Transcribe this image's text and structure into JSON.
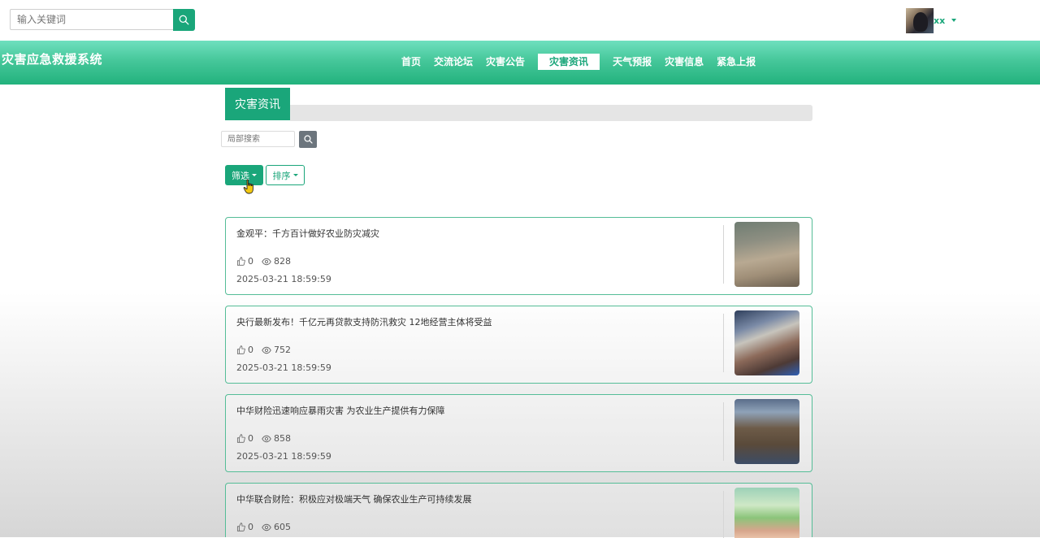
{
  "header": {
    "search_placeholder": "输入关键词",
    "username": "xx"
  },
  "navbar": {
    "brand": "灾害应急救援系统",
    "items": [
      {
        "label": "首页",
        "active": false
      },
      {
        "label": "交流论坛",
        "active": false
      },
      {
        "label": "灾害公告",
        "active": false
      },
      {
        "label": "灾害资讯",
        "active": true
      },
      {
        "label": "天气预报",
        "active": false
      },
      {
        "label": "灾害信息",
        "active": false
      },
      {
        "label": "紧急上报",
        "active": false
      }
    ]
  },
  "section": {
    "title": "灾害资讯",
    "local_search_placeholder": "局部搜索",
    "filter_label": "筛选",
    "sort_label": "排序"
  },
  "articles": [
    {
      "title": "金观平：千方百计做好农业防灾减灾",
      "likes": "0",
      "views": "828",
      "date": "2025-03-21 18:59:59"
    },
    {
      "title": "央行最新发布！千亿元再贷款支持防汛救灾 12地经营主体将受益",
      "likes": "0",
      "views": "752",
      "date": "2025-03-21 18:59:59"
    },
    {
      "title": "中华财险迅速响应暴雨灾害 为农业生产提供有力保障",
      "likes": "0",
      "views": "858",
      "date": "2025-03-21 18:59:59"
    },
    {
      "title": "中华联合财险：积极应对极端天气 确保农业生产可持续发展",
      "likes": "0",
      "views": "605",
      "date": ""
    }
  ],
  "colors": {
    "primary": "#1aa67a",
    "nav_light": "#6fe0bf",
    "card_border": "#55bd97",
    "secondary_button": "#6c757d"
  }
}
